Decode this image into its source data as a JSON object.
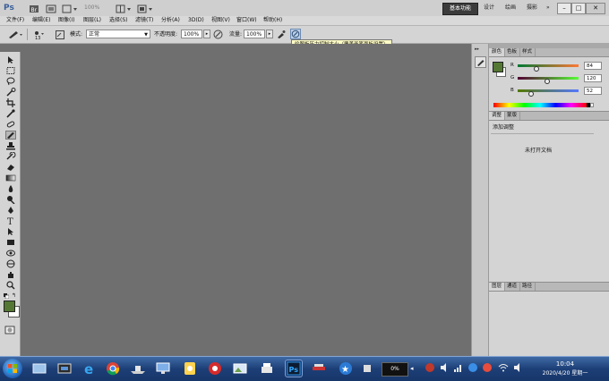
{
  "app": {
    "logo": "Ps",
    "zoom": "100%"
  },
  "workspaces": {
    "active": "基本功能",
    "items": [
      "设计",
      "绘画",
      "摄影"
    ],
    "more": "»"
  },
  "window_controls": {
    "minimize": "–",
    "restore": "□",
    "close": "✕"
  },
  "menu": [
    "文件(F)",
    "编辑(E)",
    "图像(I)",
    "图层(L)",
    "选择(S)",
    "滤镜(T)",
    "分析(A)",
    "3D(D)",
    "视图(V)",
    "窗口(W)",
    "帮助(H)"
  ],
  "options": {
    "brush_size": "13",
    "mode_label": "模式:",
    "mode_value": "正常",
    "opacity_label": "不透明度:",
    "opacity_value": "100%",
    "flow_label": "流量:",
    "flow_value": "100%"
  },
  "tooltip": "绘图板压力控制大小（覆盖画笔面板设置）",
  "panels": {
    "color_tabs": [
      "颜色",
      "色板",
      "样式"
    ],
    "r": {
      "label": "R",
      "value": "84"
    },
    "g": {
      "label": "G",
      "value": "120"
    },
    "b": {
      "label": "B",
      "value": "52"
    },
    "adjust_tabs": [
      "调整",
      "蒙版"
    ],
    "adjust_title": "添加调整",
    "no_doc": "未打开文档",
    "layer_tabs": [
      "图层",
      "通道",
      "路径"
    ]
  },
  "colors": {
    "foreground": "#547834",
    "background": "#ffffff"
  },
  "taskbar": {
    "clock_time": "10:04",
    "clock_date": "2020/4/20 星期一",
    "battery": "0%"
  }
}
